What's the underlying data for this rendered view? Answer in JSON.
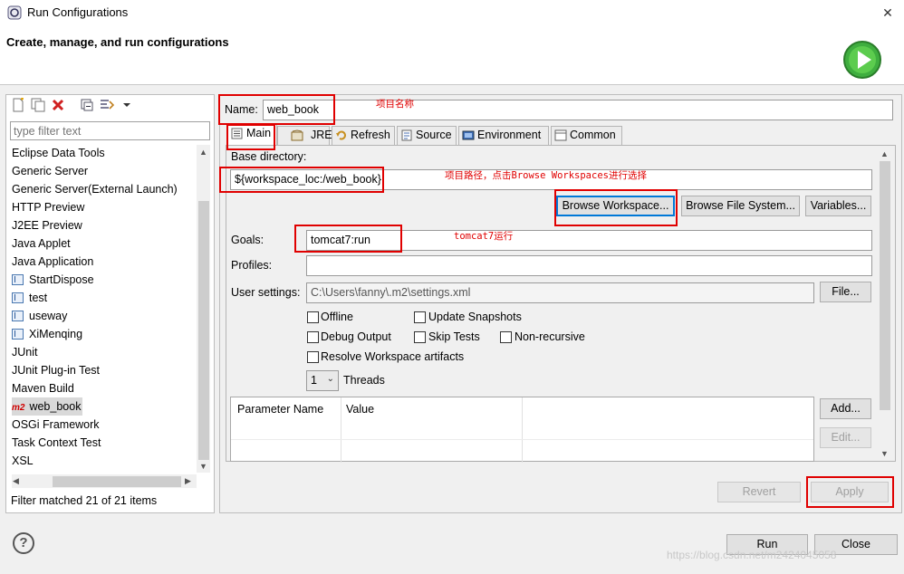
{
  "window": {
    "title": "Run Configurations",
    "close_glyph": "✕"
  },
  "header": {
    "title": "Create, manage, and run configurations",
    "icon": "run-banner-icon"
  },
  "toolbar": {
    "icons": [
      "new-config-icon",
      "duplicate-icon",
      "delete-icon",
      "collapse-all-icon",
      "filter-icon",
      "chevron-down-icon"
    ]
  },
  "filter": {
    "placeholder": "type filter text",
    "status": "Filter matched 21 of 21 items"
  },
  "tree": [
    {
      "label": "Eclipse Data Tools",
      "icon": ""
    },
    {
      "label": "Generic Server",
      "icon": ""
    },
    {
      "label": "Generic Server(External Launch)",
      "icon": ""
    },
    {
      "label": "HTTP Preview",
      "icon": ""
    },
    {
      "label": "J2EE Preview",
      "icon": ""
    },
    {
      "label": "Java Applet",
      "icon": ""
    },
    {
      "label": "Java Application",
      "icon": ""
    },
    {
      "label": "StartDispose",
      "icon": "java-config-icon"
    },
    {
      "label": "test",
      "icon": "java-config-icon"
    },
    {
      "label": "useway",
      "icon": "java-config-icon"
    },
    {
      "label": "XiMenqing",
      "icon": "java-config-icon"
    },
    {
      "label": "JUnit",
      "icon": ""
    },
    {
      "label": "JUnit Plug-in Test",
      "icon": ""
    },
    {
      "label": "Maven Build",
      "icon": ""
    },
    {
      "label": "web_book",
      "icon": "m2-icon",
      "icon_text": "m2"
    },
    {
      "label": "OSGi Framework",
      "icon": ""
    },
    {
      "label": "Task Context Test",
      "icon": ""
    },
    {
      "label": "XSL",
      "icon": ""
    }
  ],
  "config": {
    "name_label": "Name:",
    "name_value": "web_book",
    "tabs": [
      "Main",
      "JRE",
      "Refresh",
      "Source",
      "Environment",
      "Common"
    ],
    "base_dir_label": "Base directory:",
    "base_dir_value": "${workspace_loc:/web_book}",
    "browse_workspace": "Browse Workspace...",
    "browse_filesystem": "Browse File System...",
    "variables": "Variables...",
    "goals_label": "Goals:",
    "goals_value": "tomcat7:run",
    "profiles_label": "Profiles:",
    "profiles_value": "",
    "user_settings_label": "User settings:",
    "user_settings_value": "C:\\Users\\fanny\\.m2\\settings.xml",
    "file_button": "File...",
    "checkboxes": {
      "offline": "Offline",
      "update_snapshots": "Update Snapshots",
      "debug_output": "Debug Output",
      "skip_tests": "Skip Tests",
      "non_recursive": "Non-recursive",
      "resolve_workspace": "Resolve Workspace artifacts"
    },
    "threads_value": "1",
    "threads_label": "Threads",
    "param_columns": [
      "Parameter Name",
      "Value"
    ],
    "add_button": "Add...",
    "edit_button": "Edit..."
  },
  "footer": {
    "revert": "Revert",
    "apply": "Apply",
    "run": "Run",
    "close": "Close",
    "help_glyph": "?"
  },
  "annotations": {
    "project_name": "项目名称",
    "project_path": "项目路径，点击Browse Workspaces进行选择",
    "tomcat_run": "tomcat7运行"
  },
  "colors": {
    "annotation": "#e00000",
    "accent": "#0078d7"
  },
  "watermark": "https://blog.csdn.net/m2424045058"
}
